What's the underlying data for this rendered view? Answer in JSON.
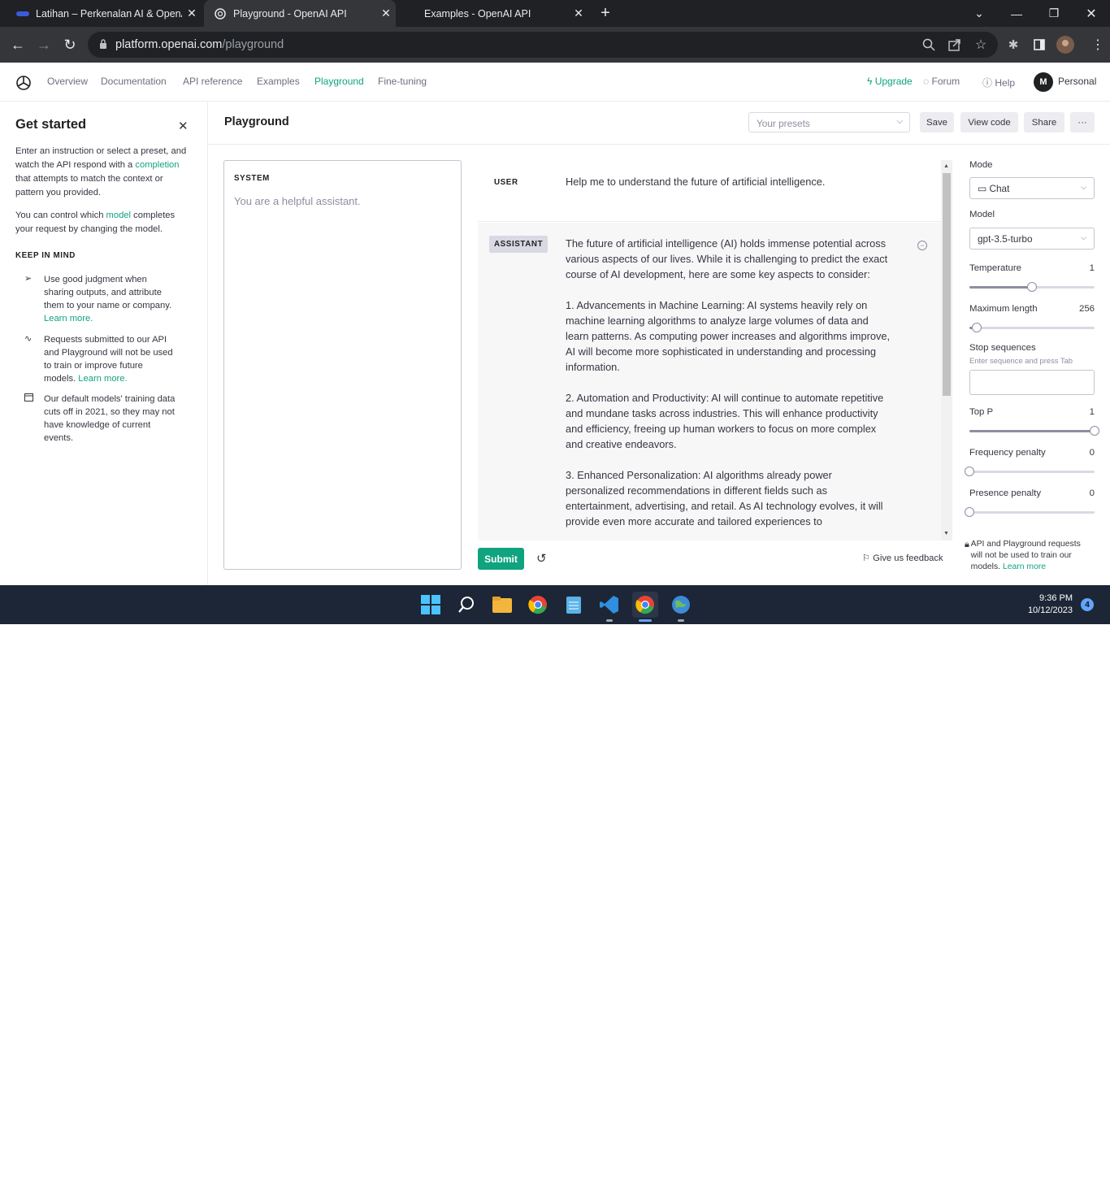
{
  "browser": {
    "tabs": [
      {
        "title": "Latihan – Perkenalan AI & OpenAI",
        "active": false
      },
      {
        "title": "Playground - OpenAI API",
        "active": true
      },
      {
        "title": "Examples - OpenAI API",
        "active": false
      }
    ],
    "url_host": "platform.openai.com",
    "url_path": "/playground"
  },
  "appnav": {
    "links": [
      "Overview",
      "Documentation",
      "API reference",
      "Examples",
      "Playground",
      "Fine-tuning"
    ],
    "active": "Playground",
    "upgrade": "Upgrade",
    "forum": "Forum",
    "help": "Help",
    "avatar_initial": "M",
    "account": "Personal"
  },
  "sidebar": {
    "title": "Get started",
    "intro_pre": "Enter an instruction or select a preset, and watch the API respond with a ",
    "intro_link": "completion",
    "intro_post": " that attempts to match the context or pattern you provided.",
    "model_pre": "You can control which ",
    "model_link": "model",
    "model_post": " completes your request by changing the model.",
    "keep_in_mind": "KEEP IN MIND",
    "tips": [
      {
        "text": "Use good judgment when sharing outputs, and attribute them to your name or company. ",
        "link": "Learn more."
      },
      {
        "text": "Requests submitted to our API and Playground will not be used to train or improve future models. ",
        "link": "Learn more."
      },
      {
        "text": "Our default models' training data cuts off in 2021, so they may not have knowledge of current events.",
        "link": ""
      }
    ]
  },
  "playground": {
    "title": "Playground",
    "presets_placeholder": "Your presets",
    "save": "Save",
    "view_code": "View code",
    "share": "Share",
    "more": "···",
    "system_label": "SYSTEM",
    "system_placeholder": "You are a helpful assistant.",
    "user_role": "USER",
    "user_message": "Help me to understand the future of artificial intelligence.",
    "assistant_role": "ASSISTANT",
    "assistant_paragraphs": [
      "The future of artificial intelligence (AI) holds immense potential across various aspects of our lives. While it is challenging to predict the exact course of AI development, here are some key aspects to consider:",
      "1. Advancements in Machine Learning: AI systems heavily rely on machine learning algorithms to analyze large volumes of data and learn patterns. As computing power increases and algorithms improve, AI will become more sophisticated in understanding and processing information.",
      "2. Automation and Productivity: AI will continue to automate repetitive and mundane tasks across industries. This will enhance productivity and efficiency, freeing up human workers to focus on more complex and creative endeavors.",
      "3. Enhanced Personalization: AI algorithms already power personalized recommendations in different fields such as entertainment, advertising, and retail. As AI technology evolves, it will provide even more accurate and tailored experiences to"
    ],
    "submit": "Submit",
    "feedback": "Give us feedback"
  },
  "settings": {
    "mode_label": "Mode",
    "mode_value": "Chat",
    "model_label": "Model",
    "model_value": "gpt-3.5-turbo",
    "temperature": {
      "label": "Temperature",
      "value": "1",
      "fraction": 0.5
    },
    "max_length": {
      "label": "Maximum length",
      "value": "256",
      "fraction": 0.06
    },
    "stop_label": "Stop sequences",
    "stop_hint": "Enter sequence and press Tab",
    "top_p": {
      "label": "Top P",
      "value": "1",
      "fraction": 1.0
    },
    "freq_penalty": {
      "label": "Frequency penalty",
      "value": "0",
      "fraction": 0.0
    },
    "pres_penalty": {
      "label": "Presence penalty",
      "value": "0",
      "fraction": 0.0
    },
    "privacy_text": "API and Playground requests will not be used to train our models. ",
    "privacy_link": "Learn more"
  },
  "taskbar": {
    "time": "9:36 PM",
    "date": "10/12/2023",
    "notifications": "4"
  },
  "colors": {
    "accent": "#10a37f",
    "taskbar": "#1c2636"
  }
}
